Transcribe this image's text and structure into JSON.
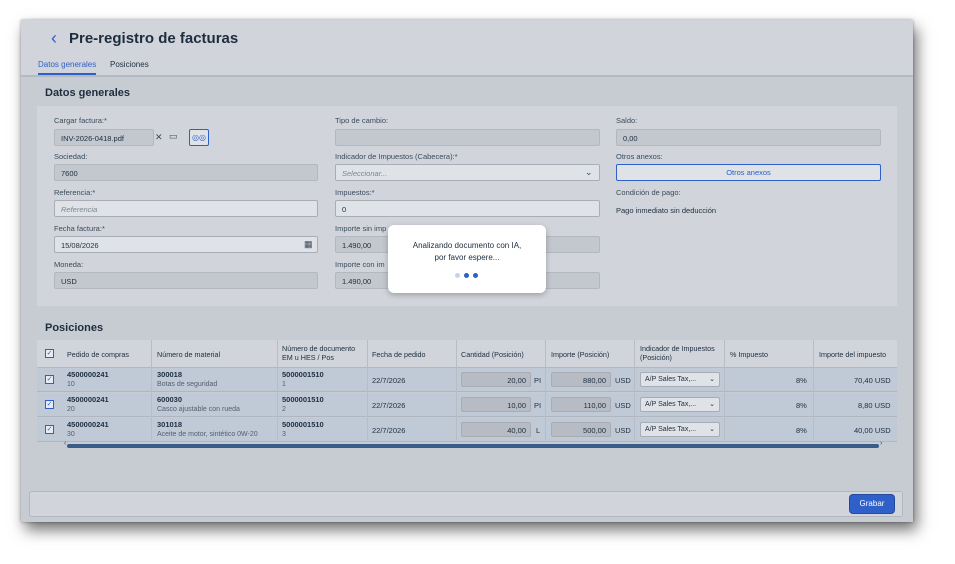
{
  "header": {
    "back_icon": "chevron-left-icon",
    "title": "Pre-registro de facturas"
  },
  "tabs": [
    {
      "label": "Datos generales",
      "active": true
    },
    {
      "label": "Posiciones",
      "active": false
    }
  ],
  "general": {
    "section_title": "Datos generales",
    "cargar_factura_label": "Cargar factura:*",
    "cargar_factura_value": "INV-2026-0418.pdf",
    "sociedad_label": "Sociedad:",
    "sociedad_value": "7600",
    "referencia_label": "Referencia:*",
    "referencia_placeholder": "Referencia",
    "fecha_label": "Fecha factura:*",
    "fecha_value": "15/08/2026",
    "moneda_label": "Moneda:",
    "moneda_value": "USD",
    "tipo_cambio_label": "Tipo de cambio:",
    "tipo_cambio_value": "",
    "indicador_label": "Indicador de Impuestos (Cabecera):*",
    "indicador_placeholder": "Seleccionar...",
    "impuestos_label": "Impuestos:*",
    "impuestos_value": "0",
    "importe_sin_label": "Importe sin imp",
    "importe_sin_value": "1.490,00",
    "importe_con_label": "Importe con im",
    "importe_con_value": "1.490,00",
    "saldo_label": "Saldo:",
    "saldo_value": "0,00",
    "otros_anexos_label": "Otros anexos:",
    "otros_anexos_button": "Otros anexos",
    "condicion_label": "Condición de pago:",
    "condicion_value": "Pago inmediato sin deducción"
  },
  "positions": {
    "section_title": "Posiciones",
    "columns": [
      "Pedido de compras",
      "Número de material",
      "Número de documento EM u HES / Pos",
      "Fecha de pedido",
      "Cantidad (Posición)",
      "Importe (Posición)",
      "Indicador de Impuestos (Posición)",
      "% Impuesto",
      "Importe del impuesto"
    ],
    "rows": [
      {
        "pedido": "4500000241",
        "pedido_pos": "10",
        "material": "300018",
        "material_desc": "Botas de seguridad",
        "documento": "5000001510",
        "documento_pos": "1",
        "fecha": "22/7/2026",
        "cantidad": "20,00",
        "unidad": "PI",
        "importe": "880,00",
        "moneda": "USD",
        "indicador": "A/P Sales Tax,...",
        "porcentaje": "8%",
        "importe_impuesto": "70,40 USD"
      },
      {
        "pedido": "4500000241",
        "pedido_pos": "20",
        "material": "600030",
        "material_desc": "Casco ajustable con rueda",
        "documento": "5000001510",
        "documento_pos": "2",
        "fecha": "22/7/2026",
        "cantidad": "10,00",
        "unidad": "PI",
        "importe": "110,00",
        "moneda": "USD",
        "indicador": "A/P Sales Tax,...",
        "porcentaje": "8%",
        "importe_impuesto": "8,80 USD"
      },
      {
        "pedido": "4500000241",
        "pedido_pos": "30",
        "material": "301018",
        "material_desc": "Aceite de motor, sintético 0W-20",
        "documento": "5000001510",
        "documento_pos": "3",
        "fecha": "22/7/2026",
        "cantidad": "40,00",
        "unidad": "L",
        "importe": "500,00",
        "moneda": "USD",
        "indicador": "A/P Sales Tax,...",
        "porcentaje": "8%",
        "importe_impuesto": "40,00 USD"
      }
    ]
  },
  "footer": {
    "save_label": "Grabar"
  },
  "modal": {
    "line1": "Analizando documento con IA,",
    "line2": "por favor espere..."
  },
  "colors": {
    "accent": "#2f5fc9",
    "overlay": "#c7ccd3"
  }
}
